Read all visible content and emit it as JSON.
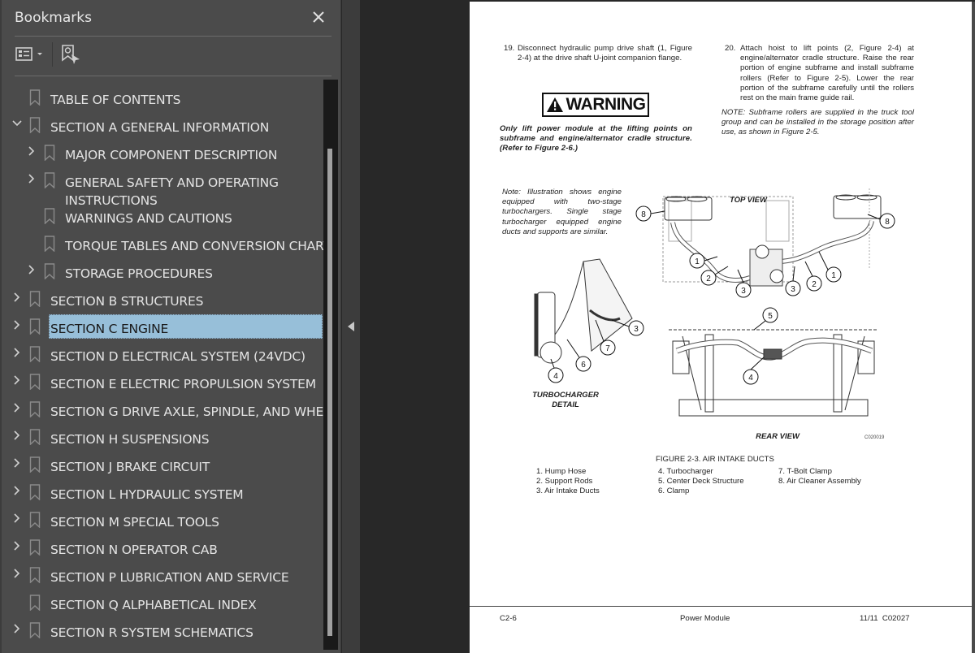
{
  "panel": {
    "title": "Bookmarks",
    "close_icon": "close-icon",
    "options_icon": "list-options-icon",
    "find_icon": "find-current-bookmark-icon"
  },
  "bookmarks": [
    {
      "label": "TABLE OF CONTENTS",
      "level": 0,
      "expander": "none"
    },
    {
      "label": "SECTION A GENERAL INFORMATION",
      "level": 0,
      "expander": "expanded"
    },
    {
      "label": "MAJOR COMPONENT DESCRIPTION",
      "level": 1,
      "expander": "collapsed"
    },
    {
      "label": "GENERAL SAFETY AND OPERATING",
      "label2": "INSTRUCTIONS",
      "level": 1,
      "expander": "collapsed"
    },
    {
      "label": "WARNINGS AND CAUTIONS",
      "level": 1,
      "expander": "none"
    },
    {
      "label": "TORQUE TABLES AND CONVERSION CHARTS",
      "level": 1,
      "expander": "none"
    },
    {
      "label": "STORAGE PROCEDURES",
      "level": 1,
      "expander": "collapsed"
    },
    {
      "label": "SECTION B STRUCTURES",
      "level": 0,
      "expander": "collapsed"
    },
    {
      "label": "SECTION C ENGINE",
      "level": 0,
      "expander": "collapsed",
      "selected": true
    },
    {
      "label": "SECTION D ELECTRICAL SYSTEM (24VDC)",
      "level": 0,
      "expander": "collapsed"
    },
    {
      "label": "SECTION E ELECTRIC PROPULSION SYSTEM",
      "level": 0,
      "expander": "collapsed"
    },
    {
      "label": "SECTION G DRIVE AXLE, SPINDLE, AND WHEELS",
      "level": 0,
      "expander": "collapsed"
    },
    {
      "label": "SECTION H SUSPENSIONS",
      "level": 0,
      "expander": "collapsed"
    },
    {
      "label": "SECTION J BRAKE CIRCUIT",
      "level": 0,
      "expander": "collapsed"
    },
    {
      "label": "SECTION L  HYDRAULIC SYSTEM",
      "level": 0,
      "expander": "collapsed"
    },
    {
      "label": "SECTION M SPECIAL TOOLS",
      "level": 0,
      "expander": "collapsed"
    },
    {
      "label": "SECTION N OPERATOR CAB",
      "level": 0,
      "expander": "collapsed"
    },
    {
      "label": "SECTION P LUBRICATION AND SERVICE",
      "level": 0,
      "expander": "collapsed"
    },
    {
      "label": "SECTION Q ALPHABETICAL INDEX",
      "level": 0,
      "expander": "none"
    },
    {
      "label": "SECTION R SYSTEM SCHEMATICS",
      "level": 0,
      "expander": "collapsed"
    }
  ],
  "colors": {
    "panel_bg": "#4b4b4b",
    "selection": "#97bfd9",
    "viewer_bg": "#282828",
    "page_bg": "#ffffff"
  },
  "document": {
    "step19": {
      "num": "19.",
      "text": "Disconnect hydraulic pump drive shaft (1, Figure 2-4) at the drive shaft U-joint companion flange."
    },
    "warning": {
      "label": "WARNING",
      "text": "Only lift power module at the lifting points on subframe and engine/alternator cradle structure. (Refer to Figure 2-6.)"
    },
    "step20": {
      "num": "20.",
      "text": "Attach hoist to lift points (2, Figure 2-4) at engine/alternator cradle structure. Raise the rear portion of engine subframe and install subframe rollers (Refer to Figure 2-5). Lower the rear portion of the subframe carefully until the rollers rest on the main frame guide rail."
    },
    "note_rollers": "NOTE: Subframe rollers are supplied in the truck tool group and can be installed in the storage position after use, as shown in Figure 2-5.",
    "figure": {
      "note": "Note: Illustration shows engine equipped with two-stage turbochargers. Single stage turbocharger equipped engine ducts and supports are similar.",
      "top_view_label": "TOP VIEW",
      "turbo_detail_label_1": "TURBOCHARGER",
      "turbo_detail_label_2": "DETAIL",
      "rear_view_label": "REAR VIEW",
      "drawing_id": "C020019",
      "caption": "FIGURE 2-3. AIR INTAKE DUCTS",
      "legend": [
        "1. Hump Hose",
        "2. Support Rods",
        "3. Air Intake Ducts",
        "4. Turbocharger",
        "5. Center Deck Structure",
        "6. Clamp",
        "7. T-Bolt Clamp",
        "8. Air Cleaner Assembly"
      ],
      "callouts": [
        "1",
        "2",
        "3",
        "4",
        "5",
        "6",
        "7",
        "8"
      ]
    },
    "footer": {
      "page": "C2-6",
      "title": "Power Module",
      "date_code": "11/11  C02027"
    }
  },
  "splitter": {
    "icon": "collapse-panel-left-icon"
  }
}
